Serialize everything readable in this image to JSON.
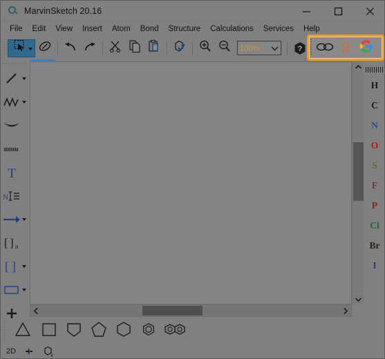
{
  "window": {
    "title": "MarvinSketch 20.16",
    "app_icon": "marvinsketch-logo-icon",
    "minimize_label": "Minimize",
    "maximize_label": "Maximize",
    "close_label": "Close"
  },
  "menubar": {
    "items": [
      {
        "label": "File"
      },
      {
        "label": "Edit"
      },
      {
        "label": "View"
      },
      {
        "label": "Insert"
      },
      {
        "label": "Atom"
      },
      {
        "label": "Bond"
      },
      {
        "label": "Structure"
      },
      {
        "label": "Calculations"
      },
      {
        "label": "Services"
      },
      {
        "label": "Help"
      }
    ]
  },
  "toolbar": {
    "buttons": [
      {
        "name": "selection-tool",
        "icon": "selection-arrow-icon",
        "active": true,
        "has_dropdown": true
      },
      {
        "name": "eraser-tool",
        "icon": "eraser-icon",
        "active": false
      },
      {
        "name": "undo-button",
        "icon": "undo-arrow-icon",
        "active": false
      },
      {
        "name": "redo-button",
        "icon": "redo-arrow-icon",
        "active": false
      },
      {
        "name": "cut-button",
        "icon": "scissors-icon",
        "active": false
      },
      {
        "name": "copy-button",
        "icon": "copy-pages-icon",
        "active": false
      },
      {
        "name": "paste-button",
        "icon": "clipboard-icon",
        "active": false
      },
      {
        "name": "structure-check-button",
        "icon": "structure-checkmark-icon",
        "active": false
      },
      {
        "name": "zoom-in-button",
        "icon": "magnifier-plus-icon",
        "active": false
      },
      {
        "name": "zoom-out-button",
        "icon": "magnifier-minus-icon",
        "active": false
      }
    ],
    "zoom": {
      "value": "100%",
      "dropdown_icon": "chevron-down-icon"
    },
    "help": {
      "icon": "help-hexagon-icon",
      "label": "?"
    }
  },
  "extension_toolbar": {
    "highlighted": true,
    "highlight_color": "#f59b19",
    "buttons": [
      {
        "name": "chemaxon-structure-search-button",
        "icon": "two-linked-rings-icon",
        "label": ""
      },
      {
        "name": "reaxys-search-button",
        "icon": "letter-r-icon",
        "label": "R"
      },
      {
        "name": "google-search-button",
        "icon": "google-g-icon",
        "label": "G"
      }
    ]
  },
  "left_toolbar": {
    "tools": [
      {
        "name": "single-bond-tool",
        "icon": "single-bond-icon",
        "has_dropdown": true
      },
      {
        "name": "chain-bond-tool",
        "icon": "zigzag-chain-icon",
        "has_dropdown": true
      },
      {
        "name": "wedge-bond-tool",
        "icon": "bold-wedge-bond-icon",
        "has_dropdown": false
      },
      {
        "name": "hashed-bond-tool",
        "icon": "hashed-wedge-bond-icon",
        "has_dropdown": false
      },
      {
        "name": "text-tool",
        "icon": "letter-t-icon",
        "has_dropdown": false
      },
      {
        "name": "atom-label-tool",
        "icon": "atom-label-n-icon",
        "has_dropdown": false
      },
      {
        "name": "reaction-arrow-tool",
        "icon": "right-arrow-icon",
        "has_dropdown": true
      },
      {
        "name": "polymer-bracket-tool",
        "icon": "bracket-n-subscript-icon",
        "has_dropdown": false
      },
      {
        "name": "bracket-tool",
        "icon": "square-brackets-icon",
        "has_dropdown": true
      },
      {
        "name": "rectangle-tool",
        "icon": "rectangle-icon",
        "has_dropdown": true
      },
      {
        "name": "charge-plus-tool",
        "icon": "plus-icon",
        "has_dropdown": false
      },
      {
        "name": "charge-minus-tool",
        "icon": "minus-icon",
        "has_dropdown": false
      }
    ]
  },
  "right_toolbar": {
    "elements": [
      {
        "symbol": "H",
        "color": "#1a1a1a"
      },
      {
        "symbol": "C",
        "color": "#1a1a1a"
      },
      {
        "symbol": "N",
        "color": "#2b4a8b"
      },
      {
        "symbol": "O",
        "color": "#c01515"
      },
      {
        "symbol": "S",
        "color": "#6b6b1a"
      },
      {
        "symbol": "F",
        "color": "#6d2f4a"
      },
      {
        "symbol": "P",
        "color": "#7a2a1e"
      },
      {
        "symbol": "Cl",
        "color": "#16702a"
      },
      {
        "symbol": "Br",
        "color": "#2a2118"
      },
      {
        "symbol": "I",
        "color": "#2f3a7a"
      }
    ]
  },
  "ring_toolbar": {
    "rings": [
      {
        "name": "cyclopropane-ring-button",
        "icon": "triangle-ring-icon",
        "sides": 3
      },
      {
        "name": "cyclobutane-ring-button",
        "icon": "square-ring-icon",
        "sides": 4
      },
      {
        "name": "cyclopentadiene-ring-button",
        "icon": "cyclopentadiene-ring-icon",
        "sides": 5
      },
      {
        "name": "cyclopentane-ring-button",
        "icon": "pentagon-ring-icon",
        "sides": 5
      },
      {
        "name": "cyclohexane-ring-button",
        "icon": "hexagon-ring-icon",
        "sides": 6
      },
      {
        "name": "benzene-ring-button",
        "icon": "benzene-aromatic-ring-icon",
        "sides": 6
      },
      {
        "name": "naphthalene-ring-button",
        "icon": "naphthalene-fused-ring-icon",
        "sides": 10
      }
    ]
  },
  "statusbar": {
    "mode_label": "2D",
    "chirality_icon": "chirality-marker-icon",
    "cleanup_icon": "structure-x-icon"
  },
  "canvas": {
    "background_color": "#848484",
    "vertical_scrollbar": {
      "up_icon": "chevron-up-icon",
      "down_icon": "chevron-down-icon",
      "thumb_position_percent": 34
    },
    "horizontal_scrollbar": {
      "left_icon": "chevron-left-icon",
      "right_icon": "chevron-right-icon",
      "thumb_position_percent": 35
    }
  }
}
